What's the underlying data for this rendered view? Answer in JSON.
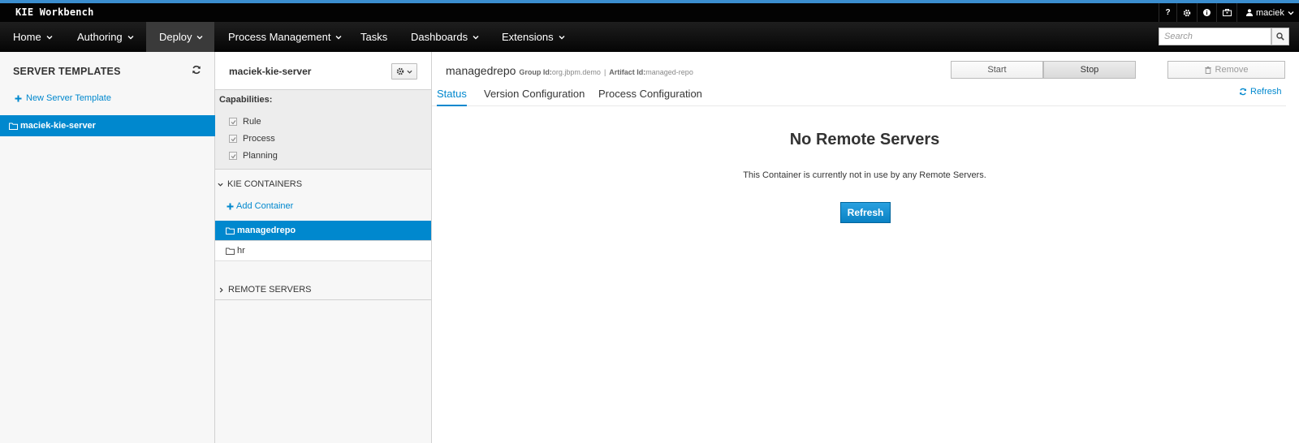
{
  "app": {
    "brand": "KIE Workbench"
  },
  "utility": {
    "help": "?",
    "user": "maciek"
  },
  "nav": {
    "items": [
      {
        "label": "Home",
        "dropdown": true
      },
      {
        "label": "Authoring",
        "dropdown": true
      },
      {
        "label": "Deploy",
        "dropdown": true,
        "active": true
      },
      {
        "label": "Process Management",
        "dropdown": true
      },
      {
        "label": "Tasks",
        "dropdown": false
      },
      {
        "label": "Dashboards",
        "dropdown": true
      },
      {
        "label": "Extensions",
        "dropdown": true
      }
    ],
    "search_placeholder": "Search"
  },
  "server_templates": {
    "title": "SERVER TEMPLATES",
    "new_label": "New Server Template",
    "items": [
      {
        "label": "maciek-kie-server",
        "selected": true
      }
    ]
  },
  "server": {
    "name": "maciek-kie-server",
    "capabilities_label": "Capabilities:",
    "capabilities": [
      {
        "label": "Rule",
        "checked": true
      },
      {
        "label": "Process",
        "checked": true
      },
      {
        "label": "Planning",
        "checked": true
      }
    ],
    "containers_title": "KIE CONTAINERS",
    "add_container": "Add Container",
    "containers": [
      {
        "label": "managedrepo",
        "selected": true
      },
      {
        "label": "hr",
        "selected": false
      }
    ],
    "remote_title": "REMOTE SERVERS"
  },
  "container": {
    "name": "managedrepo",
    "group_label": "Group Id:",
    "group_id": "org.jbpm.demo",
    "separator": "|",
    "artifact_label": "Artifact Id:",
    "artifact_id": "managed-repo",
    "start": "Start",
    "stop": "Stop",
    "remove": "Remove",
    "refresh_link": "Refresh",
    "tabs": [
      {
        "label": "Status",
        "active": true
      },
      {
        "label": "Version Configuration",
        "active": false
      },
      {
        "label": "Process Configuration",
        "active": false
      }
    ],
    "empty_title": "No Remote Servers",
    "empty_text": "This Container is currently not in use by any Remote Servers.",
    "refresh_button": "Refresh"
  },
  "colors": {
    "accent": "#0088ce",
    "topbar": "#030303",
    "top_border": "#3b8ecf",
    "nav_active": "#3a3a3a"
  }
}
